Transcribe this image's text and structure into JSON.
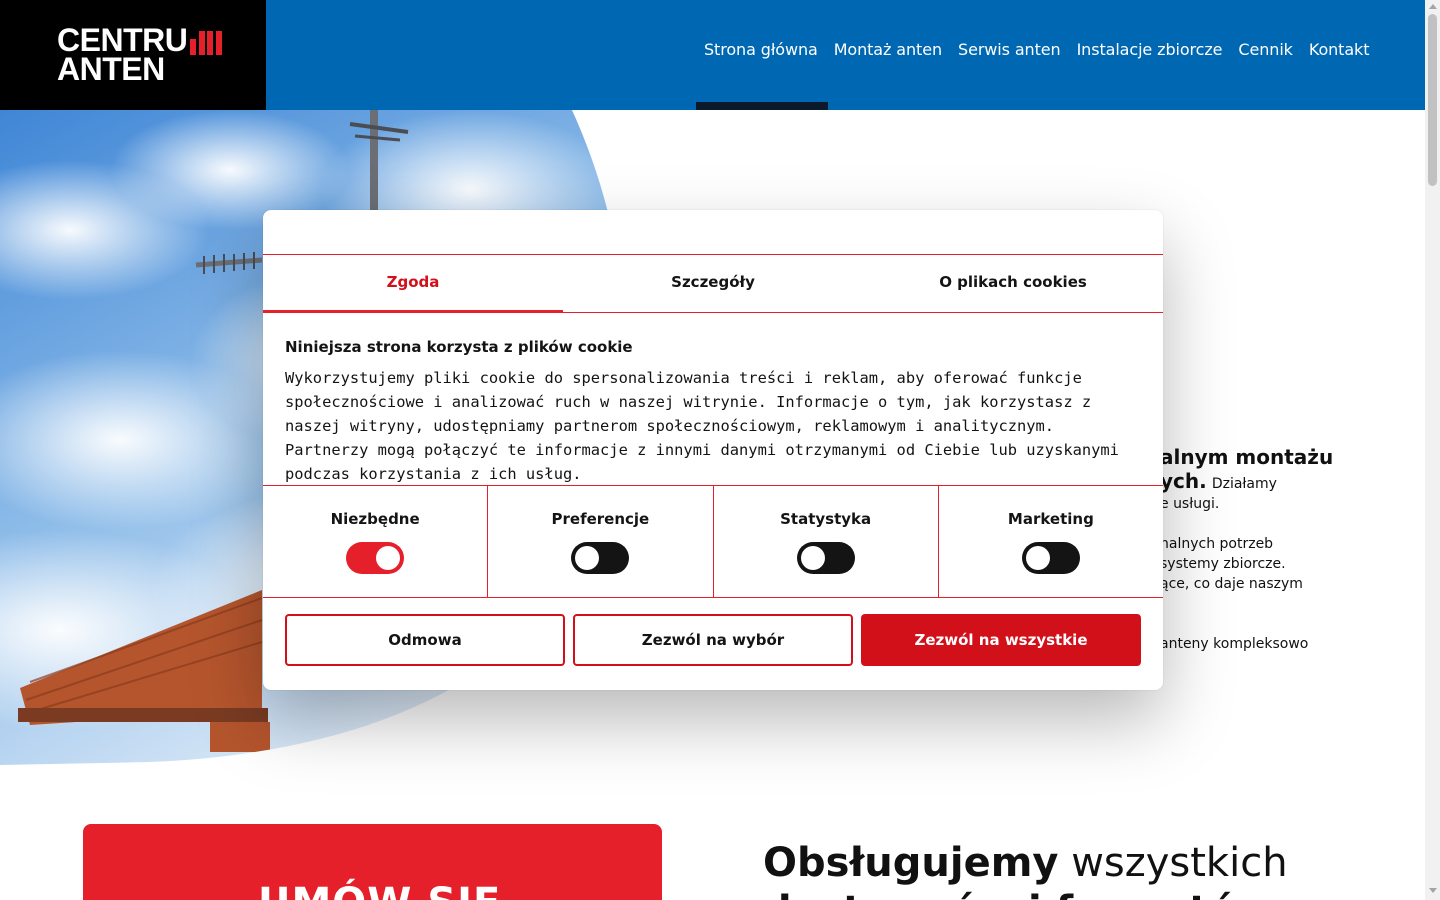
{
  "brand": {
    "logo_line1": "CENTRUM",
    "logo_line2": "ANTEN",
    "accent_color": "#e5202b",
    "header_color": "#0068b3"
  },
  "nav": {
    "items": [
      {
        "label": "Strona główna",
        "active": true
      },
      {
        "label": "Montaż anten",
        "active": false
      },
      {
        "label": "Serwis anten",
        "active": false
      },
      {
        "label": "Instalacje zbiorcze",
        "active": false
      },
      {
        "label": "Cennik",
        "active": false
      },
      {
        "label": "Kontakt",
        "active": false
      }
    ]
  },
  "hero": {
    "line1": "alnym montażu",
    "line2": "ych.",
    "line2_rest": "Działamy",
    "line3": "e usługi.",
    "p2_line1": "nalnych potrzeb",
    "p2_line2": "systemy zbiorcze.",
    "p2_line3": "ące, co daje naszym",
    "p3_line1": "anteny kompleksowo"
  },
  "lower": {
    "cta_text": "UMÓW SIĘ",
    "heading_bold": "Obsługujemy",
    "heading_rest": "wszystkich",
    "heading_line2": "dostawców i formatów"
  },
  "cookie": {
    "tabs": [
      {
        "label": "Zgoda",
        "active": true
      },
      {
        "label": "Szczegóły",
        "active": false
      },
      {
        "label": "O plikach cookies",
        "active": false
      }
    ],
    "title": "Niniejsza strona korzysta z plików cookie",
    "description": "Wykorzystujemy pliki cookie do spersonalizowania treści i reklam, aby oferować funkcje społecznościowe i analizować ruch w naszej witrynie. Informacje o tym, jak korzystasz z naszej witryny, udostępniamy partnerom społecznościowym, reklamowym i analitycznym. Partnerzy mogą połączyć te informacje z innymi danymi otrzymanymi od Ciebie lub uzyskanymi podczas korzystania z ich usług.",
    "categories": [
      {
        "label": "Niezbędne",
        "enabled": true
      },
      {
        "label": "Preferencje",
        "enabled": false
      },
      {
        "label": "Statystyka",
        "enabled": false
      },
      {
        "label": "Marketing",
        "enabled": false
      }
    ],
    "buttons": {
      "deny": "Odmowa",
      "allow_selection": "Zezwól na wybór",
      "allow_all": "Zezwól na wszystkie"
    }
  }
}
